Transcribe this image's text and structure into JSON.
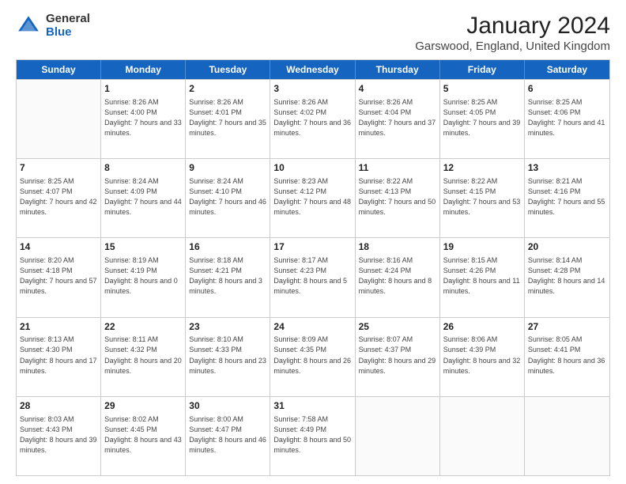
{
  "header": {
    "logo": {
      "general": "General",
      "blue": "Blue"
    },
    "title": "January 2024",
    "subtitle": "Garswood, England, United Kingdom"
  },
  "days_of_week": [
    "Sunday",
    "Monday",
    "Tuesday",
    "Wednesday",
    "Thursday",
    "Friday",
    "Saturday"
  ],
  "weeks": [
    [
      {
        "day": "",
        "sunrise": "",
        "sunset": "",
        "daylight": ""
      },
      {
        "day": "1",
        "sunrise": "Sunrise: 8:26 AM",
        "sunset": "Sunset: 4:00 PM",
        "daylight": "Daylight: 7 hours and 33 minutes."
      },
      {
        "day": "2",
        "sunrise": "Sunrise: 8:26 AM",
        "sunset": "Sunset: 4:01 PM",
        "daylight": "Daylight: 7 hours and 35 minutes."
      },
      {
        "day": "3",
        "sunrise": "Sunrise: 8:26 AM",
        "sunset": "Sunset: 4:02 PM",
        "daylight": "Daylight: 7 hours and 36 minutes."
      },
      {
        "day": "4",
        "sunrise": "Sunrise: 8:26 AM",
        "sunset": "Sunset: 4:04 PM",
        "daylight": "Daylight: 7 hours and 37 minutes."
      },
      {
        "day": "5",
        "sunrise": "Sunrise: 8:25 AM",
        "sunset": "Sunset: 4:05 PM",
        "daylight": "Daylight: 7 hours and 39 minutes."
      },
      {
        "day": "6",
        "sunrise": "Sunrise: 8:25 AM",
        "sunset": "Sunset: 4:06 PM",
        "daylight": "Daylight: 7 hours and 41 minutes."
      }
    ],
    [
      {
        "day": "7",
        "sunrise": "Sunrise: 8:25 AM",
        "sunset": "Sunset: 4:07 PM",
        "daylight": "Daylight: 7 hours and 42 minutes."
      },
      {
        "day": "8",
        "sunrise": "Sunrise: 8:24 AM",
        "sunset": "Sunset: 4:09 PM",
        "daylight": "Daylight: 7 hours and 44 minutes."
      },
      {
        "day": "9",
        "sunrise": "Sunrise: 8:24 AM",
        "sunset": "Sunset: 4:10 PM",
        "daylight": "Daylight: 7 hours and 46 minutes."
      },
      {
        "day": "10",
        "sunrise": "Sunrise: 8:23 AM",
        "sunset": "Sunset: 4:12 PM",
        "daylight": "Daylight: 7 hours and 48 minutes."
      },
      {
        "day": "11",
        "sunrise": "Sunrise: 8:22 AM",
        "sunset": "Sunset: 4:13 PM",
        "daylight": "Daylight: 7 hours and 50 minutes."
      },
      {
        "day": "12",
        "sunrise": "Sunrise: 8:22 AM",
        "sunset": "Sunset: 4:15 PM",
        "daylight": "Daylight: 7 hours and 53 minutes."
      },
      {
        "day": "13",
        "sunrise": "Sunrise: 8:21 AM",
        "sunset": "Sunset: 4:16 PM",
        "daylight": "Daylight: 7 hours and 55 minutes."
      }
    ],
    [
      {
        "day": "14",
        "sunrise": "Sunrise: 8:20 AM",
        "sunset": "Sunset: 4:18 PM",
        "daylight": "Daylight: 7 hours and 57 minutes."
      },
      {
        "day": "15",
        "sunrise": "Sunrise: 8:19 AM",
        "sunset": "Sunset: 4:19 PM",
        "daylight": "Daylight: 8 hours and 0 minutes."
      },
      {
        "day": "16",
        "sunrise": "Sunrise: 8:18 AM",
        "sunset": "Sunset: 4:21 PM",
        "daylight": "Daylight: 8 hours and 3 minutes."
      },
      {
        "day": "17",
        "sunrise": "Sunrise: 8:17 AM",
        "sunset": "Sunset: 4:23 PM",
        "daylight": "Daylight: 8 hours and 5 minutes."
      },
      {
        "day": "18",
        "sunrise": "Sunrise: 8:16 AM",
        "sunset": "Sunset: 4:24 PM",
        "daylight": "Daylight: 8 hours and 8 minutes."
      },
      {
        "day": "19",
        "sunrise": "Sunrise: 8:15 AM",
        "sunset": "Sunset: 4:26 PM",
        "daylight": "Daylight: 8 hours and 11 minutes."
      },
      {
        "day": "20",
        "sunrise": "Sunrise: 8:14 AM",
        "sunset": "Sunset: 4:28 PM",
        "daylight": "Daylight: 8 hours and 14 minutes."
      }
    ],
    [
      {
        "day": "21",
        "sunrise": "Sunrise: 8:13 AM",
        "sunset": "Sunset: 4:30 PM",
        "daylight": "Daylight: 8 hours and 17 minutes."
      },
      {
        "day": "22",
        "sunrise": "Sunrise: 8:11 AM",
        "sunset": "Sunset: 4:32 PM",
        "daylight": "Daylight: 8 hours and 20 minutes."
      },
      {
        "day": "23",
        "sunrise": "Sunrise: 8:10 AM",
        "sunset": "Sunset: 4:33 PM",
        "daylight": "Daylight: 8 hours and 23 minutes."
      },
      {
        "day": "24",
        "sunrise": "Sunrise: 8:09 AM",
        "sunset": "Sunset: 4:35 PM",
        "daylight": "Daylight: 8 hours and 26 minutes."
      },
      {
        "day": "25",
        "sunrise": "Sunrise: 8:07 AM",
        "sunset": "Sunset: 4:37 PM",
        "daylight": "Daylight: 8 hours and 29 minutes."
      },
      {
        "day": "26",
        "sunrise": "Sunrise: 8:06 AM",
        "sunset": "Sunset: 4:39 PM",
        "daylight": "Daylight: 8 hours and 32 minutes."
      },
      {
        "day": "27",
        "sunrise": "Sunrise: 8:05 AM",
        "sunset": "Sunset: 4:41 PM",
        "daylight": "Daylight: 8 hours and 36 minutes."
      }
    ],
    [
      {
        "day": "28",
        "sunrise": "Sunrise: 8:03 AM",
        "sunset": "Sunset: 4:43 PM",
        "daylight": "Daylight: 8 hours and 39 minutes."
      },
      {
        "day": "29",
        "sunrise": "Sunrise: 8:02 AM",
        "sunset": "Sunset: 4:45 PM",
        "daylight": "Daylight: 8 hours and 43 minutes."
      },
      {
        "day": "30",
        "sunrise": "Sunrise: 8:00 AM",
        "sunset": "Sunset: 4:47 PM",
        "daylight": "Daylight: 8 hours and 46 minutes."
      },
      {
        "day": "31",
        "sunrise": "Sunrise: 7:58 AM",
        "sunset": "Sunset: 4:49 PM",
        "daylight": "Daylight: 8 hours and 50 minutes."
      },
      {
        "day": "",
        "sunrise": "",
        "sunset": "",
        "daylight": ""
      },
      {
        "day": "",
        "sunrise": "",
        "sunset": "",
        "daylight": ""
      },
      {
        "day": "",
        "sunrise": "",
        "sunset": "",
        "daylight": ""
      }
    ]
  ]
}
